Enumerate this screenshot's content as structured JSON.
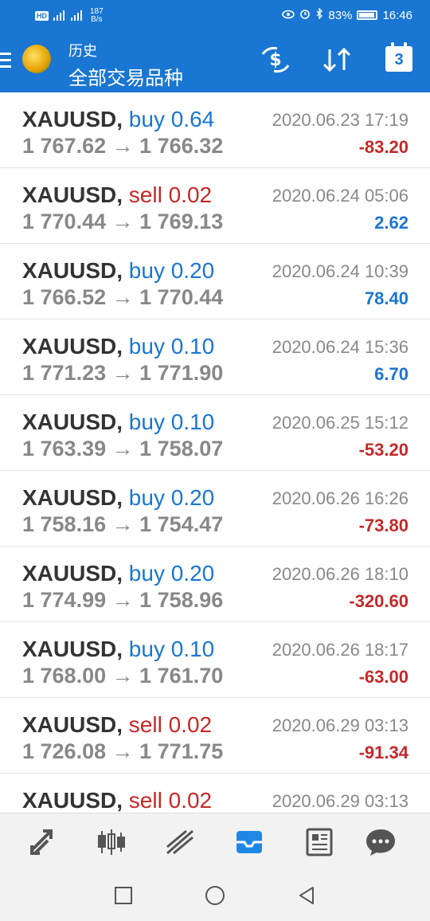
{
  "status_bar": {
    "network_badge": "HD",
    "speed": "187",
    "speed_unit": "B/s",
    "battery": "83%",
    "time": "16:46"
  },
  "app_bar": {
    "title": "历史",
    "subtitle": "全部交易品种",
    "calendar_day": "3"
  },
  "trades": [
    {
      "symbol": "XAUUSD,",
      "side": "buy",
      "volume": "0.64",
      "open": "1 767.62",
      "close": "1 766.32",
      "date": "2020.06.23 17:19",
      "profit": "-83.20"
    },
    {
      "symbol": "XAUUSD,",
      "side": "sell",
      "volume": "0.02",
      "open": "1 770.44",
      "close": "1 769.13",
      "date": "2020.06.24 05:06",
      "profit": "2.62"
    },
    {
      "symbol": "XAUUSD,",
      "side": "buy",
      "volume": "0.20",
      "open": "1 766.52",
      "close": "1 770.44",
      "date": "2020.06.24 10:39",
      "profit": "78.40"
    },
    {
      "symbol": "XAUUSD,",
      "side": "buy",
      "volume": "0.10",
      "open": "1 771.23",
      "close": "1 771.90",
      "date": "2020.06.24 15:36",
      "profit": "6.70"
    },
    {
      "symbol": "XAUUSD,",
      "side": "buy",
      "volume": "0.10",
      "open": "1 763.39",
      "close": "1 758.07",
      "date": "2020.06.25 15:12",
      "profit": "-53.20"
    },
    {
      "symbol": "XAUUSD,",
      "side": "buy",
      "volume": "0.20",
      "open": "1 758.16",
      "close": "1 754.47",
      "date": "2020.06.26 16:26",
      "profit": "-73.80"
    },
    {
      "symbol": "XAUUSD,",
      "side": "buy",
      "volume": "0.20",
      "open": "1 774.99",
      "close": "1 758.96",
      "date": "2020.06.26 18:10",
      "profit": "-320.60"
    },
    {
      "symbol": "XAUUSD,",
      "side": "buy",
      "volume": "0.10",
      "open": "1 768.00",
      "close": "1 761.70",
      "date": "2020.06.26 18:17",
      "profit": "-63.00"
    },
    {
      "symbol": "XAUUSD,",
      "side": "sell",
      "volume": "0.02",
      "open": "1 726.08",
      "close": "1 771.75",
      "date": "2020.06.29 03:13",
      "profit": "-91.34"
    },
    {
      "symbol": "XAUUSD,",
      "side": "sell",
      "volume": "0.02",
      "open": "",
      "close": "",
      "date": "2020.06.29 03:13",
      "profit": ""
    }
  ],
  "tabs": [
    {
      "icon": "trade-arrows-icon"
    },
    {
      "icon": "candlestick-chart-icon"
    },
    {
      "icon": "trend-lines-icon"
    },
    {
      "icon": "history-inbox-icon",
      "active": true
    },
    {
      "icon": "news-icon"
    },
    {
      "icon": "chat-icon"
    }
  ],
  "colors": {
    "header_bg": "#1976d2",
    "buy": "#1976d2",
    "sell": "#c62828",
    "profit_positive": "#1976d2",
    "profit_negative": "#c62828",
    "muted_text": "#888888"
  }
}
